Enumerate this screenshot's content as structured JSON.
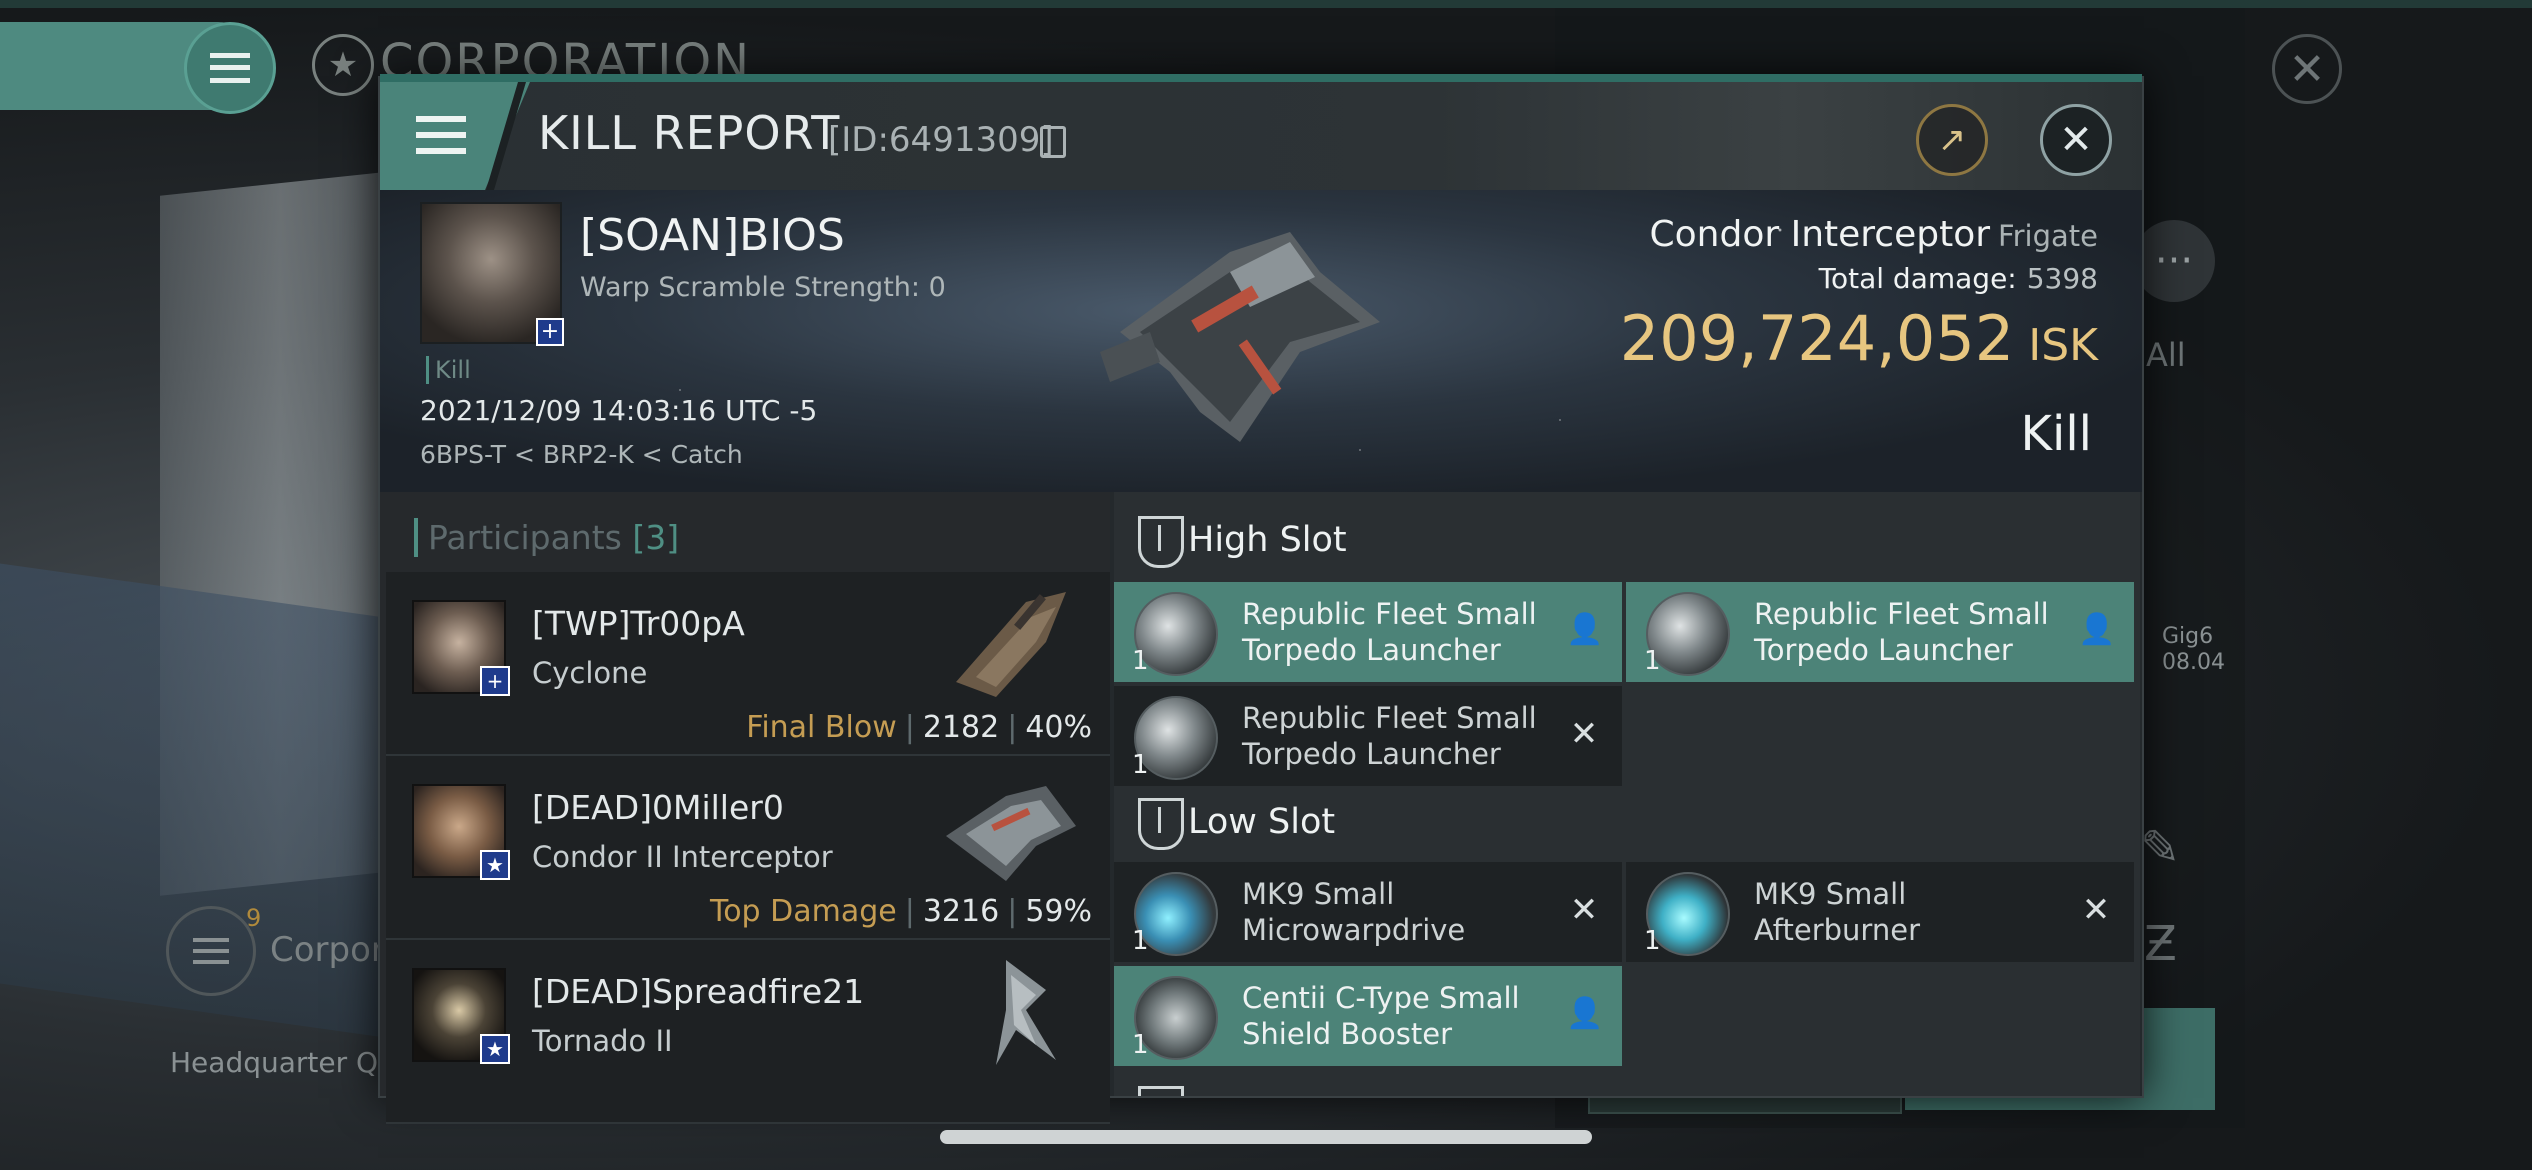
{
  "background": {
    "corp_title": "CORPORATION",
    "all_label": "All",
    "gig_label": "Gig6",
    "gig_sub": "08.04",
    "corp_row_label": "Corpor",
    "corp_row_count": "9",
    "hq_label": "Headquarter Q-T"
  },
  "header": {
    "title": "KILL REPORT",
    "report_id": "[ID:6491309]"
  },
  "victim": {
    "name": "[SOAN]BIOS",
    "warp_scramble": "Warp Scramble Strength: 0",
    "tag": "Kill",
    "datetime": "2021/12/09 14:03:16 UTC -5",
    "location": "6BPS-T < BRP2-K < Catch",
    "ship_name": "Condor Interceptor",
    "ship_class": "Frigate",
    "total_damage_label": "Total damage:",
    "total_damage": "5398",
    "isk_value": "209,724,052",
    "isk_unit": "ISK",
    "result_label": "Kill"
  },
  "participants": {
    "label": "Participants",
    "count": "[3]",
    "rows": [
      {
        "name": "[TWP]Tr00pA",
        "ship": "Cyclone",
        "role": "Final Blow",
        "damage": "2182",
        "percent": "40%",
        "badge": "+"
      },
      {
        "name": "[DEAD]0Miller0",
        "ship": "Condor II Interceptor",
        "role": "Top Damage",
        "damage": "3216",
        "percent": "59%",
        "badge": "★"
      },
      {
        "name": "[DEAD]Spreadfire21",
        "ship": "Tornado II",
        "role": "",
        "damage": "",
        "percent": "",
        "badge": "★"
      }
    ]
  },
  "fitting": {
    "high_slot_label": "High Slot",
    "low_slot_label": "Low Slot",
    "high_slot": [
      {
        "name_line1": "Republic Fleet Small",
        "name_line2": "Torpedo Launcher",
        "qty": "1",
        "status": "dropped",
        "icon": "torpedo-launcher-icon"
      },
      {
        "name_line1": "Republic Fleet Small",
        "name_line2": "Torpedo Launcher",
        "qty": "1",
        "status": "dropped",
        "icon": "torpedo-launcher-icon"
      },
      {
        "name_line1": "Republic Fleet Small",
        "name_line2": "Torpedo Launcher",
        "qty": "1",
        "status": "destroyed",
        "icon": "torpedo-launcher-icon"
      }
    ],
    "low_slot": [
      {
        "name_line1": "MK9 Small",
        "name_line2": "Microwarpdrive",
        "qty": "1",
        "status": "destroyed",
        "icon": "microwarpdrive-icon"
      },
      {
        "name_line1": "MK9 Small",
        "name_line2": "Afterburner",
        "qty": "1",
        "status": "destroyed",
        "icon": "afterburner-icon"
      },
      {
        "name_line1": "Centii C-Type Small",
        "name_line2": "Shield Booster",
        "qty": "1",
        "status": "dropped",
        "icon": "shield-booster-icon"
      }
    ]
  },
  "colors": {
    "accent": "#4f8f84",
    "dropped_bg": "#4c8378",
    "isk_gold": "#e7c680",
    "role_gold": "#c59d53"
  }
}
